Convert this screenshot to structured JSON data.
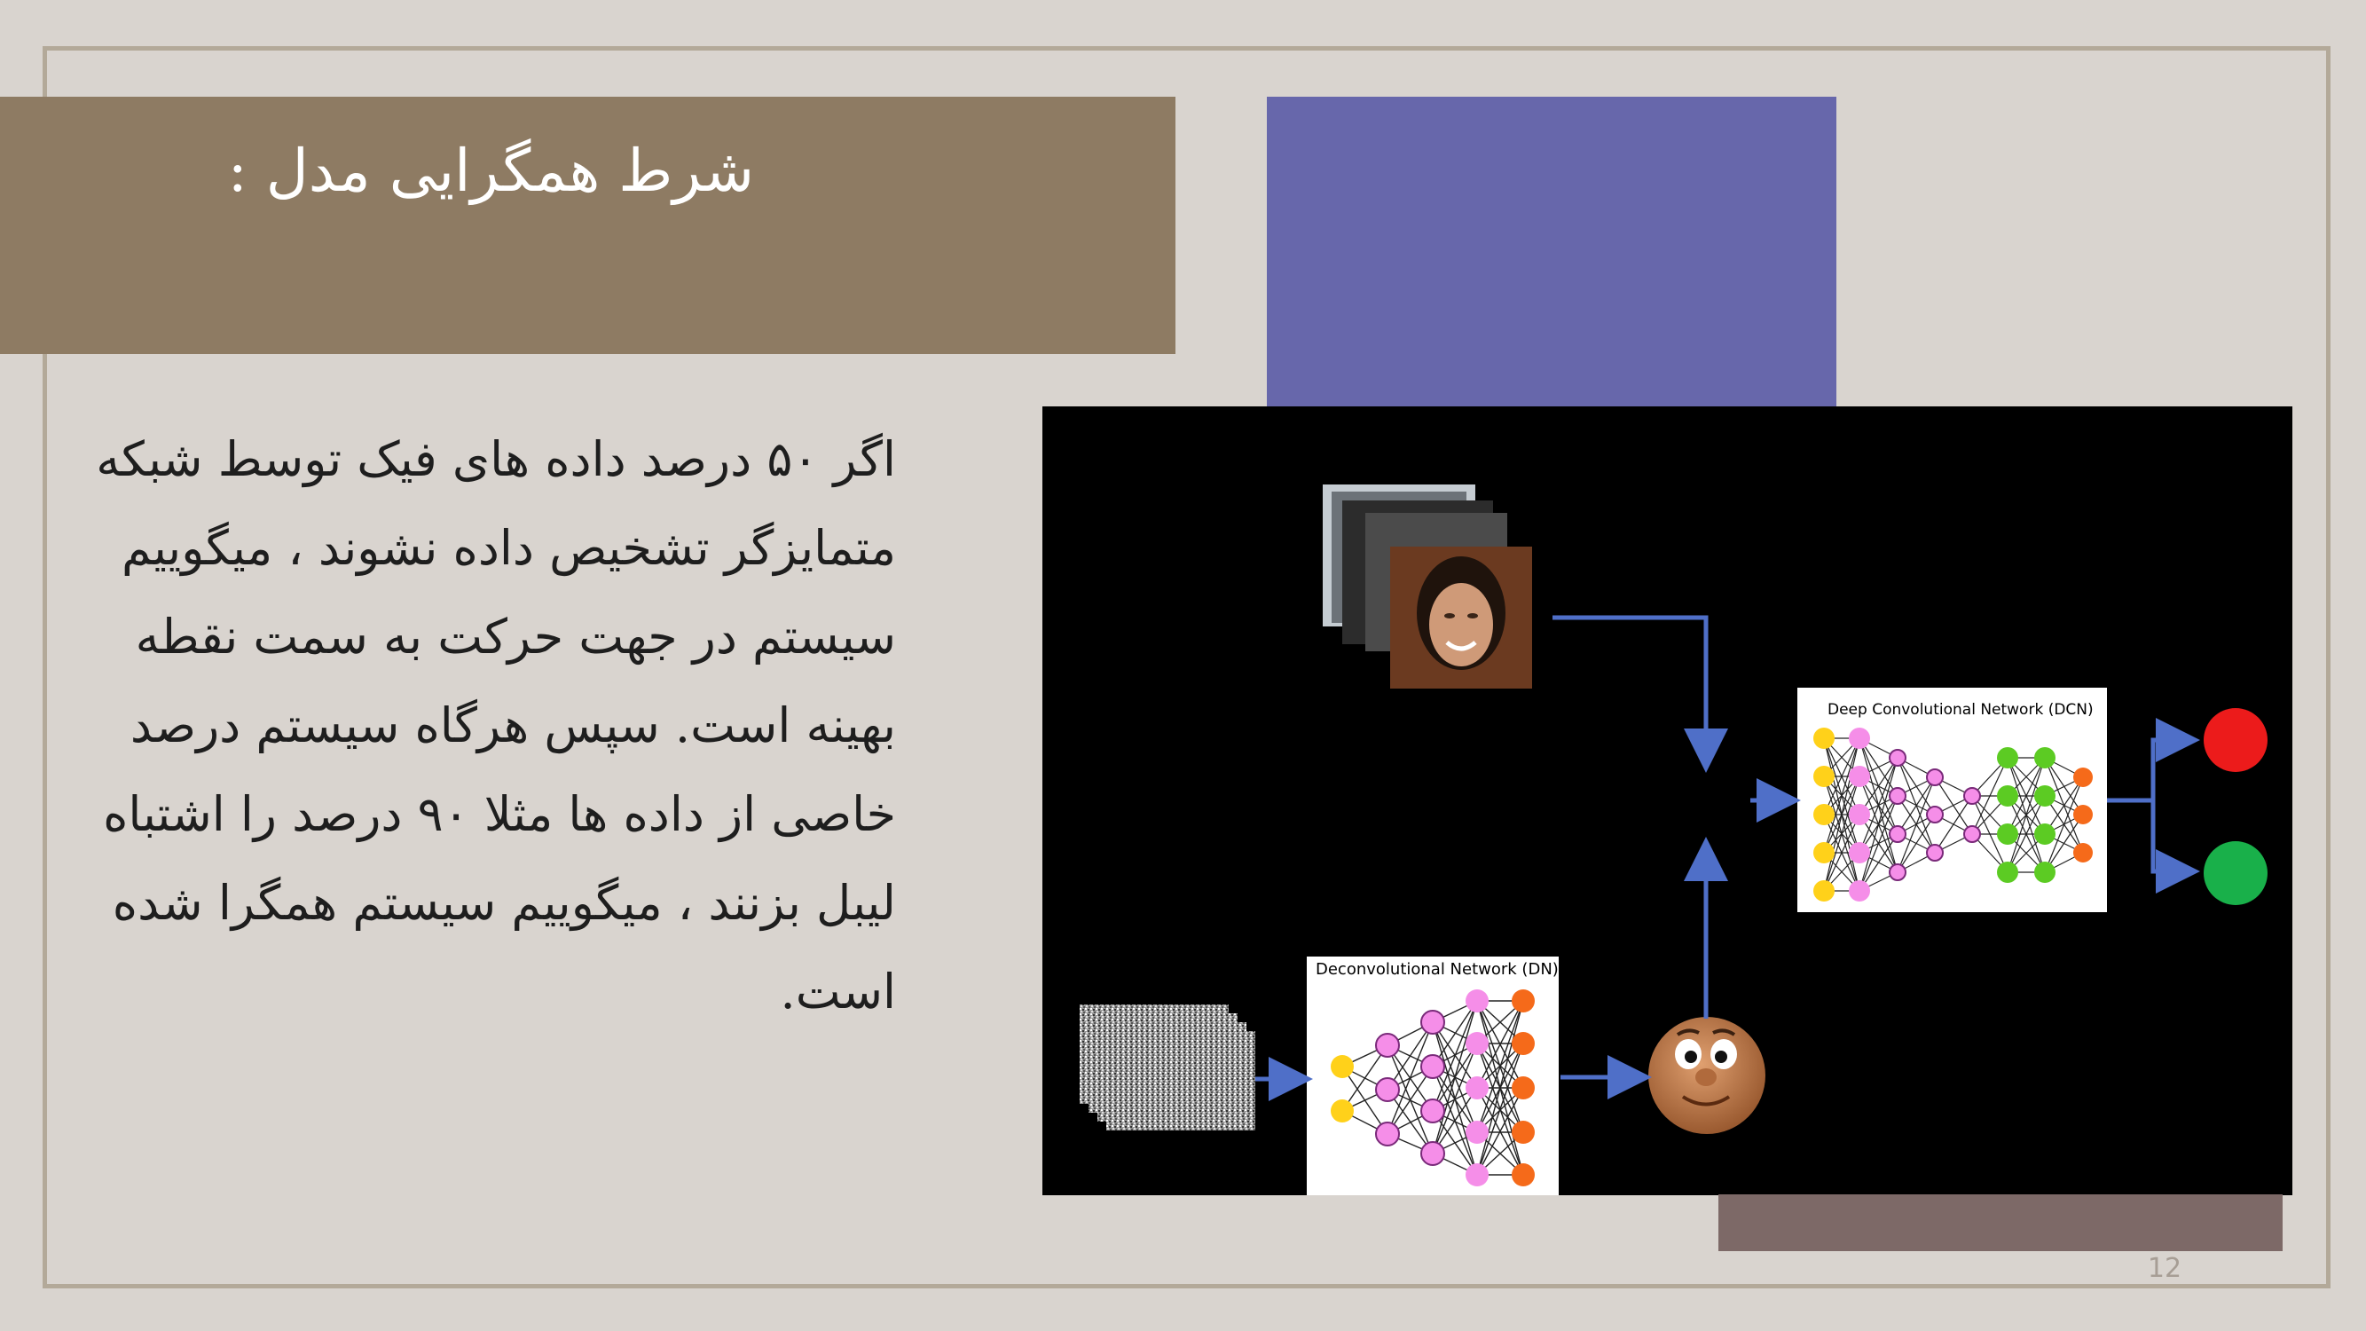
{
  "slide": {
    "title": "شرط همگرایی مدل :",
    "body_lines": [
      "اگر ۵۰ درصد داده های فیک توسط شبکه",
      "متمایزگر تشخیص داده نشوند ، میگوییم",
      "سیستم در جهت حرکت به سمت نقطه",
      "بهینه است. سپس هرگاه سیستم درصد",
      "خاصی از داده ها مثلا ۹۰ درصد را اشتباه",
      "لیبل بزنند ، میگوییم سیستم همگرا شده",
      "است."
    ],
    "page_number": "12"
  },
  "diagram": {
    "dcn_label": "Deep Convolutional Network (DCN)",
    "dn_label": "Deconvolutional Network (DN)",
    "colors": {
      "arrow": "#4f6fc8",
      "input_node": "#ffd11a",
      "hidden_node": "#f58ee8",
      "dcn_green": "#5ccb23",
      "output_node": "#f56a1a",
      "output_real": "#ec1b1b",
      "output_fake": "#19b04a",
      "background": "#d9d4cf",
      "title_band": "#8e7b63",
      "blue_block": "#6767ab",
      "mauve_block": "#7d6967"
    },
    "icons": [
      "face-photo-stack-icon",
      "noise-image-stack-icon",
      "cartoon-face-icon"
    ]
  }
}
